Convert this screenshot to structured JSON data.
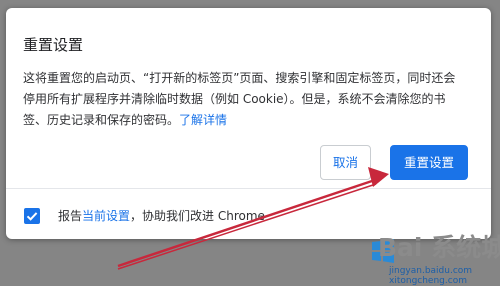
{
  "dialog": {
    "title": "重置设置",
    "message_line1": "这将重置您的启动页、“打开新的标签页”页面、搜索引擎和固定标签页，同时还会",
    "message_line2": "停用所有扩展程序并清除临时数据（例如 Cookie）。但是，系统不会清除您的书",
    "message_line3_text": "签、历史记录和保存的密码。",
    "learn_more": "了解详情",
    "cancel_label": "取消",
    "reset_label": "重置设置",
    "report_prefix": "报告",
    "report_link": "当前设置",
    "report_suffix": "，协助我们改进 Chrome",
    "report_checked": true,
    "accent_color": "#1a73e8"
  },
  "annotation": {
    "arrow_color": "#c8283c"
  },
  "watermark": {
    "brand_text": "Bai 系统城",
    "site_text": "jingyan.baidu.com",
    "site_text2": "xitongcheng.com",
    "icon": "windows-flag-icon"
  }
}
